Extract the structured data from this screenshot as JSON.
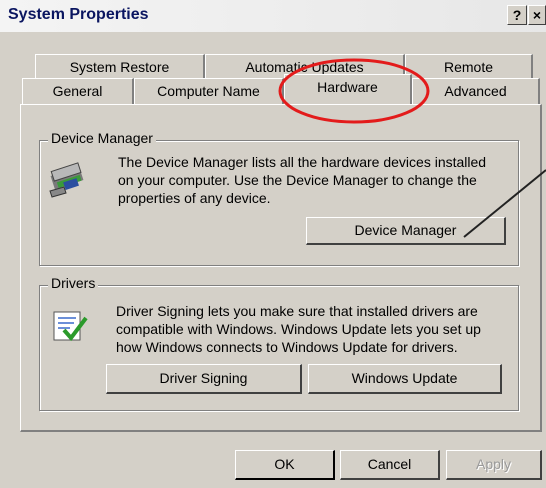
{
  "window": {
    "title": "System Properties"
  },
  "titlebar_buttons": {
    "help": "?",
    "close": "×"
  },
  "tabs": {
    "system_restore": "System Restore",
    "automatic_updates": "Automatic Updates",
    "remote": "Remote",
    "general": "General",
    "computer_name": "Computer Name",
    "hardware": "Hardware",
    "advanced": "Advanced"
  },
  "device_manager": {
    "group_label": "Device Manager",
    "desc_lines": [
      "The Device Manager lists all the hardware devices installed",
      "on your computer. Use the Device Manager to change the",
      "properties of any device."
    ],
    "button": "Device Manager"
  },
  "drivers": {
    "group_label": "Drivers",
    "desc_lines": [
      "Driver Signing lets you make sure that installed drivers are",
      "compatible with Windows. Windows Update lets you set up",
      "how Windows connects to Windows Update for drivers."
    ],
    "signing_button": "Driver Signing",
    "update_button": "Windows Update"
  },
  "footer": {
    "ok": "OK",
    "cancel": "Cancel",
    "apply": "Apply"
  },
  "colors": {
    "face": "#d4d0c8",
    "title_text": "#0a1560",
    "annotation": "#e31b1b"
  }
}
